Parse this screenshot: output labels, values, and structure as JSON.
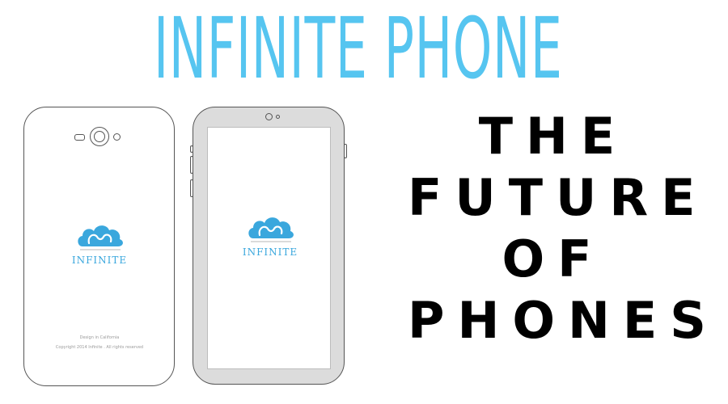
{
  "headline": "INFINITE PHONE",
  "logo": {
    "word": "INFINITE",
    "icon": "cloud-icon"
  },
  "back_text": {
    "design": "Design in California",
    "copyright": "Copyright 2014 Infinite . All rights reserved"
  },
  "tagline": [
    "THE",
    "FUTURE",
    "OF",
    "PHONES"
  ],
  "colors": {
    "brand_blue": "#56c5f0",
    "logo_blue": "#3aa7dd",
    "text": "#000000",
    "outline": "#555555",
    "frame_gray": "#dcdcdc"
  }
}
